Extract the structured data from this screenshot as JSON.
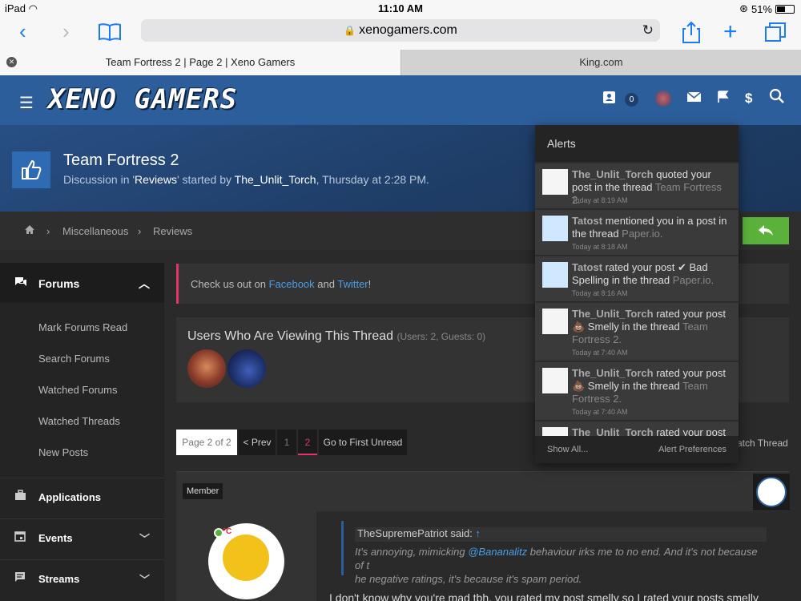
{
  "status": {
    "device": "iPad",
    "time": "11:10 AM",
    "battery": "51%",
    "battery_level": 0.51
  },
  "browser": {
    "url": "xenogamers.com",
    "tabs": [
      {
        "label": "Team Fortress 2 | Page 2 | Xeno Gamers",
        "active": true
      },
      {
        "label": "King.com",
        "active": false
      }
    ]
  },
  "header": {
    "logo": "XENO GAMERS",
    "conversations_count": "0",
    "dollar": "$"
  },
  "thread": {
    "title": "Team Fortress 2",
    "sub_prefix": "Discussion in '",
    "forum": "Reviews",
    "sub_mid": "' started by ",
    "author": "The_Unlit_Torch",
    "sub_suffix": ", Thursday at 2:28 PM."
  },
  "breadcrumb": [
    "Miscellaneous",
    "Reviews"
  ],
  "sidebar": {
    "forums_label": "Forums",
    "forums_items": [
      "Mark Forums Read",
      "Search Forums",
      "Watched Forums",
      "Watched Threads",
      "New Posts"
    ],
    "sections": [
      "Applications",
      "Events",
      "Streams"
    ]
  },
  "notice": {
    "prefix": "Check us out on ",
    "facebook": "Facebook",
    "and": " and ",
    "twitter": "Twitter",
    "suffix": "!"
  },
  "viewers": {
    "title": "Users Who Are Viewing This Thread",
    "counts": "(Users: 2, Guests: 0)"
  },
  "pagination": {
    "label": "Page 2 of 2",
    "prev": "< Prev",
    "page1": "1",
    "page2": "2",
    "first_unread": "Go to First Unread",
    "watch": "atch Thread"
  },
  "post": {
    "user_title": "Member",
    "avatar_text": "°C",
    "quote_author": "TheSupremePatriot said:",
    "quote_arrow": "↑",
    "quote_line1_pre": "It's annoying, mimicking ",
    "quote_mention": "@Bananalitz",
    "quote_line1_post": " behaviour irks me to no end. And it's not because of t",
    "quote_line2": "he negative ratings, it's because it's spam period.",
    "text": "I don't know why you're mad tbh, you rated my post smelly so I rated your posts smelly"
  },
  "alerts": {
    "title": "Alerts",
    "items": [
      {
        "user": "The_Unlit_Torch",
        "line": " quoted your post in the thread ",
        "thread": "Team Fortress 2.",
        "time": "Today at 8:19 AM"
      },
      {
        "user": "Tatost",
        "line": " mentioned you in a post in the thread ",
        "thread": "Paper.io.",
        "time": "Today at 8:18 AM"
      },
      {
        "user": "Tatost",
        "line": " rated your post ✔ Bad Spelling in the thread ",
        "thread": "Paper.io.",
        "time": "Today at 8:16 AM"
      },
      {
        "user": "The_Unlit_Torch",
        "line": " rated your post 💩 Smelly in the thread ",
        "thread": "Team Fortress 2.",
        "time": "Today at 7:40 AM"
      },
      {
        "user": "The_Unlit_Torch",
        "line": " rated your post 💩 Smelly in the thread ",
        "thread": "Team Fortress 2.",
        "time": "Today at 7:40 AM"
      },
      {
        "user": "The_Unlit_Torch",
        "line": " rated your post",
        "thread": "",
        "time": ""
      }
    ],
    "show_all": "Show All...",
    "preferences": "Alert Preferences"
  },
  "colors": {
    "header": "#2d5e9c",
    "accent": "#e03566",
    "link": "#4a9ee8",
    "reply": "#5bb23b"
  }
}
